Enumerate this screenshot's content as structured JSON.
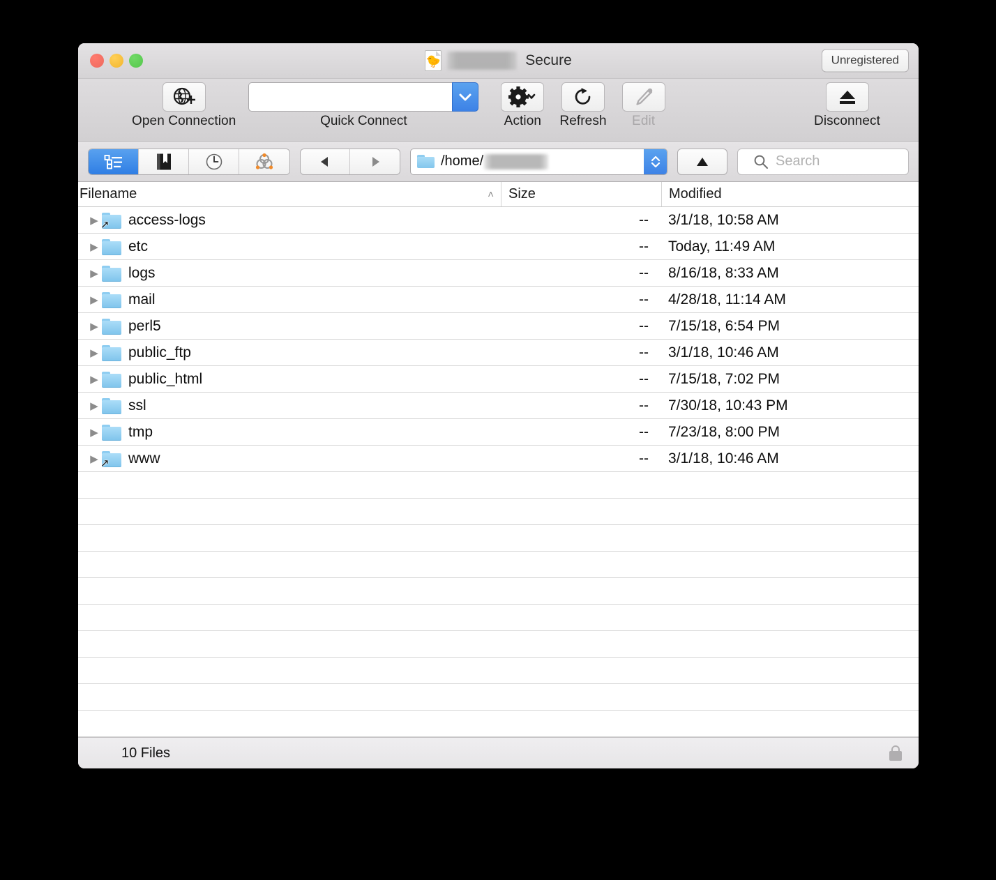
{
  "window": {
    "title_text": "Secure",
    "title_icon": "duck-document-icon",
    "title_redacted": true,
    "unregistered_badge": "Unregistered"
  },
  "toolbar": {
    "items": [
      {
        "label": "Open Connection",
        "icon": "globe-plus-icon",
        "enabled": true
      },
      {
        "label": "Quick Connect",
        "icon": "chevron-down-icon",
        "enabled": true
      },
      {
        "label": "Action",
        "icon": "gear-icon",
        "enabled": true
      },
      {
        "label": "Refresh",
        "icon": "refresh-icon",
        "enabled": true
      },
      {
        "label": "Edit",
        "icon": "pencil-icon",
        "enabled": false
      },
      {
        "label": "Disconnect",
        "icon": "eject-icon",
        "enabled": true
      }
    ],
    "quick_connect_value": "",
    "quick_connect_placeholder": ""
  },
  "navbar": {
    "view_modes": [
      {
        "name": "browser-view",
        "icon": "list-outline-icon",
        "active": true
      },
      {
        "name": "bookmarks-view",
        "icon": "bookmark-icon",
        "active": false
      },
      {
        "name": "history-view",
        "icon": "clock-icon",
        "active": false
      },
      {
        "name": "bonjour-view",
        "icon": "network-icon",
        "active": false
      }
    ],
    "back_icon": "triangle-left-icon",
    "forward_icon": "triangle-right-icon",
    "path_value": "/home/",
    "path_redacted": true,
    "parent_icon": "triangle-up-icon",
    "search_placeholder": "Search",
    "search_value": ""
  },
  "table": {
    "columns": [
      "Filename",
      "Size",
      "Modified"
    ],
    "sort_column": "Filename",
    "sort_direction": "ascending",
    "sort_glyph": "˄",
    "rows": [
      {
        "name": "access-logs",
        "size": "--",
        "modified": "3/1/18, 10:58 AM",
        "symlink": true
      },
      {
        "name": "etc",
        "size": "--",
        "modified": "Today, 11:49 AM",
        "symlink": false
      },
      {
        "name": "logs",
        "size": "--",
        "modified": "8/16/18, 8:33 AM",
        "symlink": false
      },
      {
        "name": "mail",
        "size": "--",
        "modified": "4/28/18, 11:14 AM",
        "symlink": false
      },
      {
        "name": "perl5",
        "size": "--",
        "modified": "7/15/18, 6:54 PM",
        "symlink": false
      },
      {
        "name": "public_ftp",
        "size": "--",
        "modified": "3/1/18, 10:46 AM",
        "symlink": false
      },
      {
        "name": "public_html",
        "size": "--",
        "modified": "7/15/18, 7:02 PM",
        "symlink": false
      },
      {
        "name": "ssl",
        "size": "--",
        "modified": "7/30/18, 10:43 PM",
        "symlink": false
      },
      {
        "name": "tmp",
        "size": "--",
        "modified": "7/23/18, 8:00 PM",
        "symlink": false
      },
      {
        "name": "www",
        "size": "--",
        "modified": "3/1/18, 10:46 AM",
        "symlink": true
      }
    ],
    "empty_row_count": 10,
    "disclosure_glyph": "▶"
  },
  "statusbar": {
    "text": "10 Files",
    "lock_icon": "lock-icon"
  },
  "colors": {
    "accent_blue": "#3d82e6",
    "folder_blue": "#8ecdf1",
    "background": "#000000",
    "chrome": "#dedcde"
  }
}
